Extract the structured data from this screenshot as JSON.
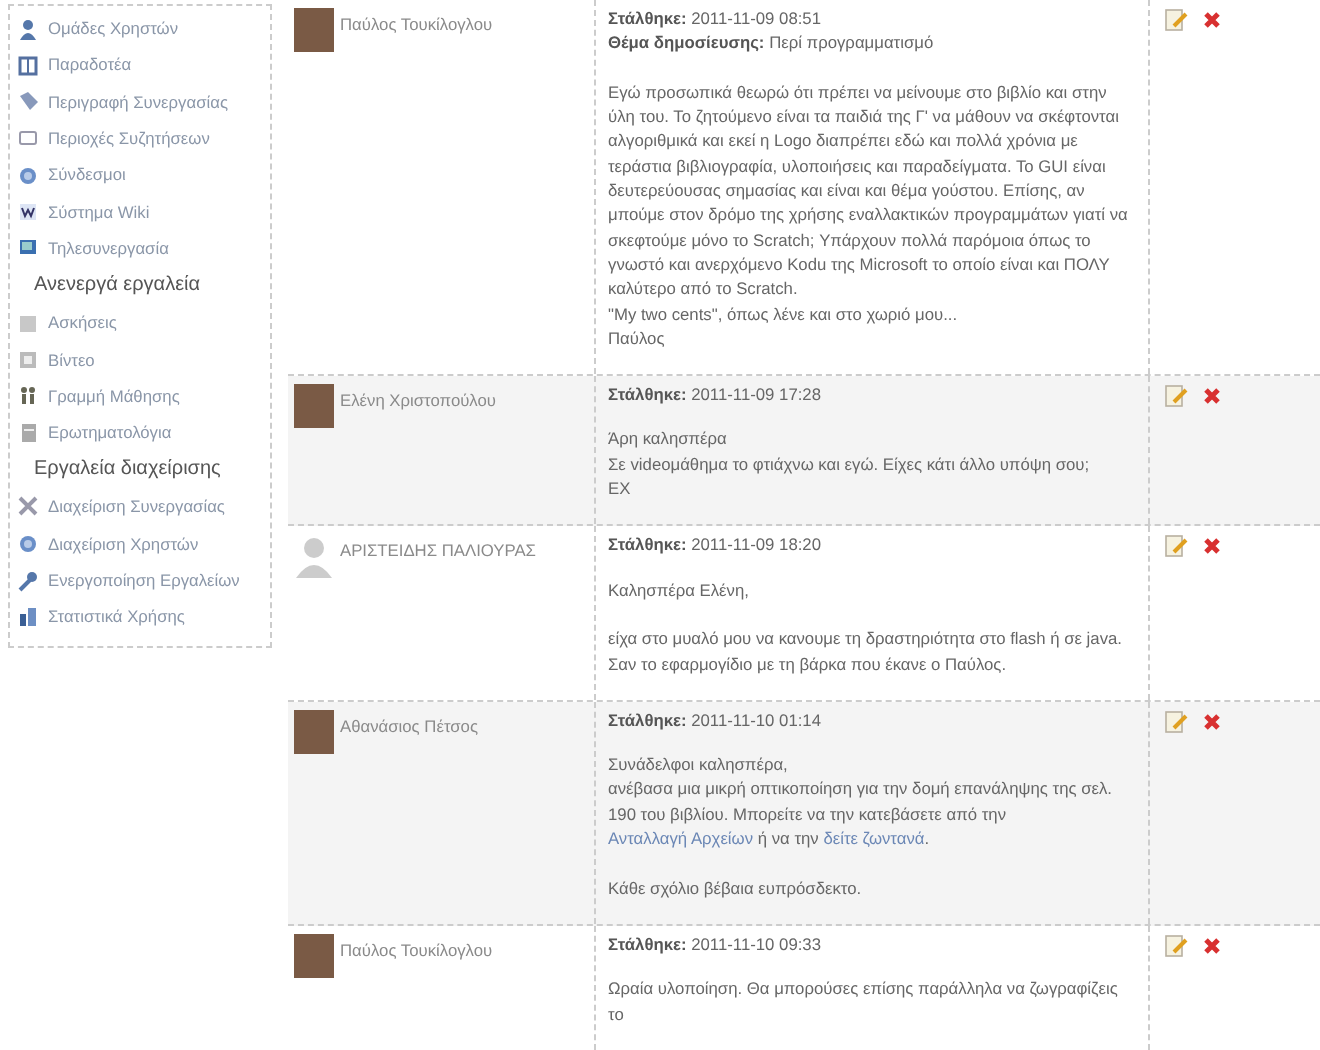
{
  "sidebar": {
    "sections": [
      {
        "items": [
          {
            "label": "Ομάδες Χρηστών"
          },
          {
            "label": "Παραδοτέα"
          },
          {
            "label": "Περιγραφή Συνεργασίας"
          },
          {
            "label": "Περιοχές Συζητήσεων"
          },
          {
            "label": "Σύνδεσμοι"
          },
          {
            "label": "Σύστημα Wiki"
          },
          {
            "label": "Τηλεσυνεργασία"
          }
        ]
      },
      {
        "title": "Ανενεργά εργαλεία",
        "items": [
          {
            "label": "Ασκήσεις"
          },
          {
            "label": "Βίντεο"
          },
          {
            "label": "Γραμμή Μάθησης"
          },
          {
            "label": "Ερωτηματολόγια"
          }
        ]
      },
      {
        "title": "Εργαλεία διαχείρισης",
        "items": [
          {
            "label": "Διαχείριση Συνεργασίας"
          },
          {
            "label": "Διαχείριση Χρηστών"
          },
          {
            "label": "Ενεργοποίηση Εργαλείων"
          },
          {
            "label": "Στατιστικά Χρήσης"
          }
        ]
      }
    ]
  },
  "posts": [
    {
      "author": "Παύλος Τουκίλογλου",
      "kind": "photo",
      "posted_label": "Στάλθηκε:",
      "posted": "2011-11-09 08:51",
      "subject_label": "Θέμα δημοσίευσης:",
      "subject": "Περί προγραμματισμό",
      "blocks": [
        [
          [
            {
              "kind": "text",
              "text": "Εγώ προσωπικά θεωρώ ότι πρέπει να μείνουμε στο βιβλίο και στην ύλη του. Το ζητούμενο είναι τα παιδιά της Γ' να μάθουν να σκέφτονται αλγοριθμικά και εκεί η Logo διαπρέπει εδώ και πολλά χρόνια με τεράστια βιβλιογραφία, υλοποιήσεις και παραδείγματα. Το GUI είναι δευτερεύουσας σημασίας και είναι και θέμα γούστου. Επίσης, αν μπούμε στον δρόμο της χρήσης εναλλακτικών προγραμμάτων γιατί να σκεφτούμε μόνο το Scratch; Υπάρχουν πολλά παρόμοια όπως το γνωστό και ανερχόμενο Kodu της Microsoft το οποίο είναι και ΠΟΛΥ καλύτερο από το Scratch."
            }
          ],
          [
            {
              "kind": "text",
              "text": "\"My two cents\", όπως λένε και στο χωριό μου..."
            }
          ],
          [
            {
              "kind": "text",
              "text": "Παύλος"
            }
          ]
        ]
      ]
    },
    {
      "author": "Ελένη Χριστοπούλου",
      "kind": "photo",
      "posted_label": "Στάλθηκε:",
      "posted": "2011-11-09 17:28",
      "blocks": [
        [
          [
            {
              "kind": "text",
              "text": "Άρη καλησπέρα"
            }
          ],
          [
            {
              "kind": "text",
              "text": "Σε videoμάθημα το φτιάχνω και εγώ. Είχες κάτι άλλο υπόψη σου;"
            }
          ],
          [
            {
              "kind": "text",
              "text": "ΕΧ"
            }
          ]
        ]
      ]
    },
    {
      "author": "ΑΡΙΣΤΕΙΔΗΣ ΠΑΛΙΟΥΡΑΣ",
      "kind": "default",
      "posted_label": "Στάλθηκε:",
      "posted": "2011-11-09 18:20",
      "blocks": [
        [
          [
            {
              "kind": "text",
              "text": "Καλησπέρα Ελένη,"
            }
          ]
        ],
        [
          [
            {
              "kind": "text",
              "text": "είχα στο μυαλό μου να κανουμε τη δραστηριότητα στο flash ή σε java."
            }
          ],
          [
            {
              "kind": "text",
              "text": "Σαν το εφαρμογίδιο με τη βάρκα που έκανε ο Παύλος."
            }
          ]
        ]
      ]
    },
    {
      "author": "Αθανάσιος Πέτσος",
      "kind": "photo",
      "posted_label": "Στάλθηκε:",
      "posted": "2011-11-10 01:14",
      "blocks": [
        [
          [
            {
              "kind": "text",
              "text": "Συνάδελφοι καλησπέρα,"
            }
          ],
          [
            {
              "kind": "text",
              "text": "ανέβασα μια μικρή οπτικοποίηση για την δομή επανάληψης της σελ. 190 του βιβλίου. Μπορείτε να την κατεβάσετε από την "
            },
            {
              "kind": "link",
              "text": "Ανταλλαγή Αρχείων"
            },
            {
              "kind": "text",
              "text": " ή να την "
            },
            {
              "kind": "link",
              "text": "δείτε ζωντανά"
            },
            {
              "kind": "text",
              "text": "."
            }
          ]
        ],
        [
          [
            {
              "kind": "text",
              "text": "Κάθε σχόλιο βέβαια ευπρόσδεκτο."
            }
          ]
        ]
      ]
    },
    {
      "author": "Παύλος Τουκίλογλου",
      "kind": "photo",
      "posted_label": "Στάλθηκε:",
      "posted": "2011-11-10 09:33",
      "blocks": [
        [
          [
            {
              "kind": "text",
              "text": "Ωραία υλοποίηση. Θα μπορούσες επίσης παράλληλα να ζωγραφίζεις το"
            }
          ]
        ]
      ]
    }
  ]
}
